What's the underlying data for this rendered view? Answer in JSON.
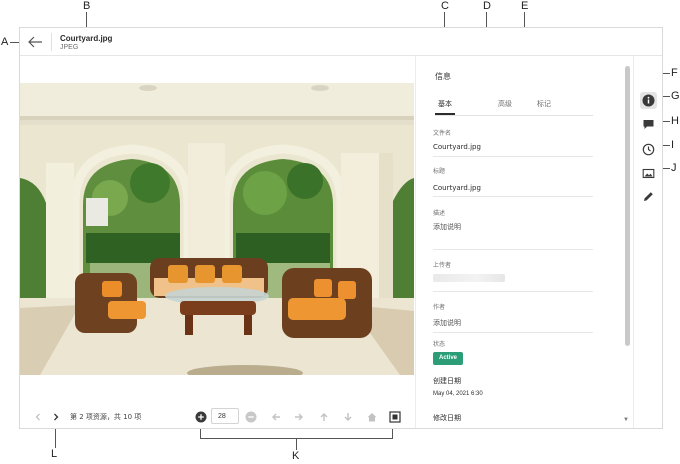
{
  "header": {
    "file_name": "Courtyard.jpg",
    "file_type": "JPEG"
  },
  "viewer": {
    "pager_text": "第 2 项资源，共 10 项",
    "zoom_value": "28"
  },
  "panel": {
    "title": "信息",
    "tabs": [
      {
        "label": "基本",
        "active": true
      },
      {
        "label": "高级",
        "active": false
      },
      {
        "label": "标记",
        "active": false
      }
    ],
    "fields": {
      "filename_label": "文件名",
      "filename_value": "Courtyard.jpg",
      "title_label": "标题",
      "title_value": "Courtyard.jpg",
      "description_label": "描述",
      "description_placeholder": "添加说明",
      "uploader_label": "上传者",
      "author_label": "作者",
      "author_placeholder": "添加说明",
      "status_label": "状态",
      "status_value": "Active",
      "created_label": "创建日期",
      "created_value": "May 04, 2021 6:30",
      "modified_label": "修改日期"
    }
  },
  "colors": {
    "status_active": "#2d9d78",
    "rail_active_bg": "#e4e4e4"
  },
  "icons": {
    "rail": [
      "info-icon",
      "comment-icon",
      "clock-icon",
      "image-icon",
      "pencil-icon"
    ],
    "toolbar": [
      "add-icon",
      "subtract-icon",
      "arrow-left-icon",
      "arrow-right-icon",
      "arrow-up-icon",
      "arrow-down-icon",
      "home-icon",
      "fit-screen-icon"
    ]
  },
  "callouts": {
    "A": "A",
    "B": "B",
    "C": "C",
    "D": "D",
    "E": "E",
    "F": "F",
    "G": "G",
    "H": "H",
    "I": "I",
    "J": "J",
    "K": "K",
    "L": "L"
  }
}
